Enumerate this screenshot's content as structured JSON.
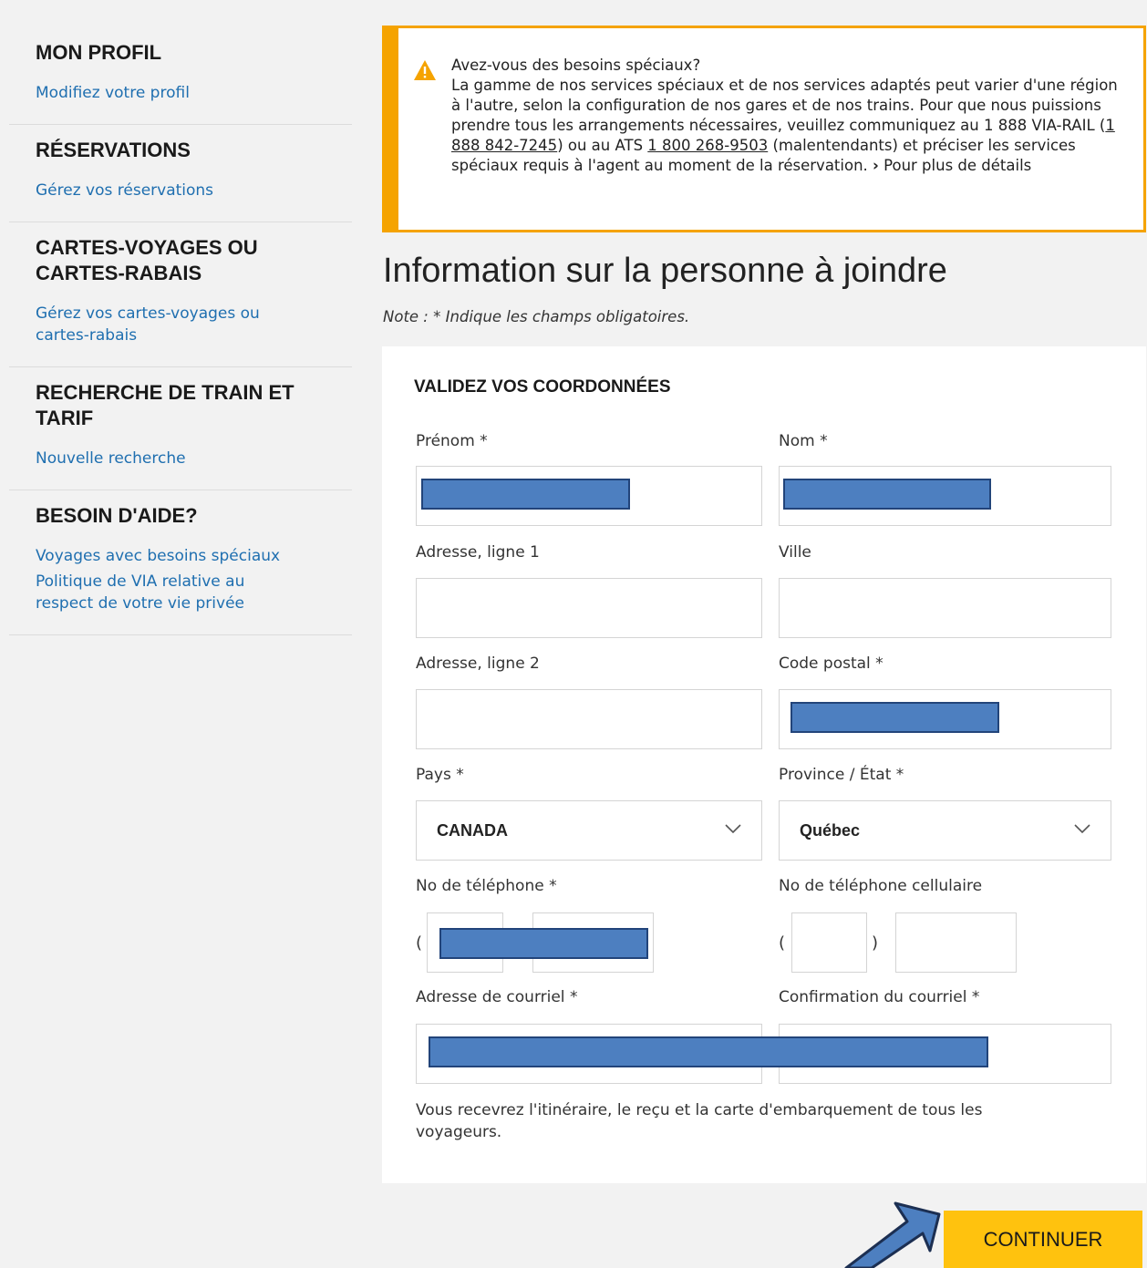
{
  "sidebar": {
    "sections": [
      {
        "heading": "MON PROFIL",
        "links": [
          "Modifiez votre profil"
        ]
      },
      {
        "heading": "RÉSERVATIONS",
        "links": [
          "Gérez vos réservations"
        ]
      },
      {
        "heading": "CARTES-VOYAGES OU CARTES-RABAIS",
        "links": [
          "Gérez vos cartes-voyages ou cartes-rabais"
        ]
      },
      {
        "heading": "RECHERCHE DE TRAIN ET TARIF",
        "links": [
          "Nouvelle recherche"
        ]
      },
      {
        "heading": "BESOIN D'AIDE?",
        "links": [
          "Voyages avec besoins spéciaux",
          "Politique de VIA relative au respect de votre vie privée"
        ]
      }
    ]
  },
  "notice": {
    "title": "Avez-vous des besoins spéciaux?",
    "body_1": "La gamme de nos services spéciaux et de nos services adaptés peut varier d'une région à l'autre, selon la configuration de nos gares et de nos trains. Pour que nous puissions prendre tous les arrangements nécessaires, veuillez communiquez au 1 888 VIA-RAIL (",
    "phone_1": "1 888 842-7245",
    "body_2": ") ou au ATS ",
    "phone_2": "1 800 268-9503",
    "body_3": " (malentendants) et préciser les services spéciaux requis à l'agent au moment de la réservation.",
    "more_marker": "›",
    "more_link": "Pour plus de détails"
  },
  "page_title": "Information sur la personne à joindre",
  "note": "Note : * Indique les champs obligatoires.",
  "form": {
    "heading": "VALIDEZ VOS COORDONNÉES",
    "labels": {
      "first_name": "Prénom *",
      "last_name": "Nom *",
      "address1": "Adresse, ligne 1",
      "city": "Ville",
      "address2": "Adresse, ligne 2",
      "postal": "Code postal *",
      "country": "Pays *",
      "province": "Province / État *",
      "phone": "No de téléphone *",
      "mobile": "No de téléphone cellulaire",
      "email": "Adresse de courriel *",
      "email_confirm": "Confirmation du courriel *"
    },
    "country_value": "CANADA",
    "province_value": "Québec",
    "paren_open": "(",
    "paren_close": ")",
    "hint": "Vous recevrez l'itinéraire, le reçu et la carte d'embarquement de tous les voyageurs."
  },
  "continue_label": "CONTINUER",
  "colors": {
    "accent": "#f5a300",
    "button": "#ffc20e",
    "link": "#1f6fb0",
    "redaction": "#4d7fc0"
  }
}
